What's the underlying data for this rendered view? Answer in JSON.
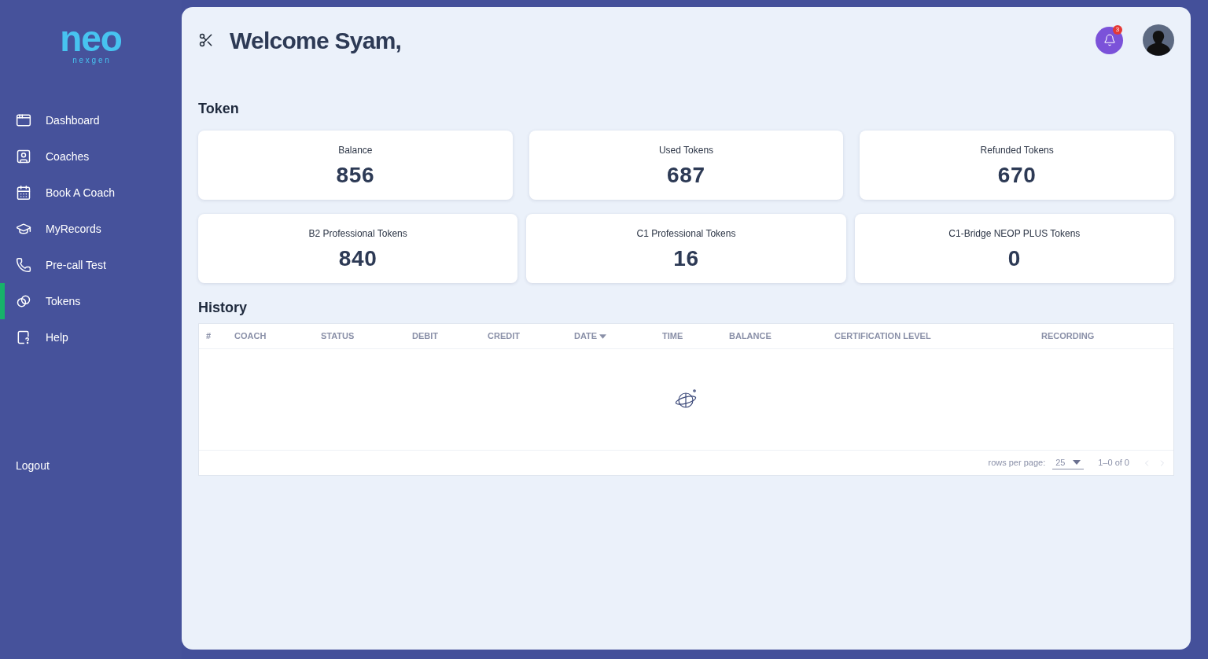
{
  "logo": {
    "mark": "neo",
    "tagline": "n e x g e n"
  },
  "nav": [
    {
      "label": "Dashboard",
      "selected": false
    },
    {
      "label": "Coaches",
      "selected": false
    },
    {
      "label": "Book A Coach",
      "selected": false
    },
    {
      "label": "MyRecords",
      "selected": false
    },
    {
      "label": "Pre-call Test",
      "selected": false
    },
    {
      "label": "Tokens",
      "selected": true
    },
    {
      "label": "Help",
      "selected": false
    }
  ],
  "logout": "Logout",
  "header": {
    "title": "Welcome Syam,",
    "notifications": "3"
  },
  "token_section": {
    "title": "Token",
    "rows": [
      [
        {
          "label": "Balance",
          "value": "856"
        },
        {
          "label": "Used Tokens",
          "value": "687"
        },
        {
          "label": "Refunded Tokens",
          "value": "670"
        }
      ],
      [
        {
          "label": "B2 Professional Tokens",
          "value": "840"
        },
        {
          "label": "C1 Professional Tokens",
          "value": "16"
        },
        {
          "label": "C1-Bridge NEOP PLUS Tokens",
          "value": "0"
        }
      ]
    ]
  },
  "history": {
    "title": "History",
    "columns": [
      {
        "label": "#",
        "sorted": false
      },
      {
        "label": "COACH",
        "sorted": false
      },
      {
        "label": "STATUS",
        "sorted": false
      },
      {
        "label": "DEBIT",
        "sorted": false
      },
      {
        "label": "CREDIT",
        "sorted": false
      },
      {
        "label": "DATE",
        "sorted": true
      },
      {
        "label": "TIME",
        "sorted": false
      },
      {
        "label": "BALANCE",
        "sorted": false
      },
      {
        "label": "CERTIFICATION LEVEL",
        "sorted": false
      },
      {
        "label": "RECORDING",
        "sorted": false
      }
    ],
    "rows_per_page_label": "rows per page:",
    "rows_per_page": "25",
    "range": "1–0 of 0"
  }
}
